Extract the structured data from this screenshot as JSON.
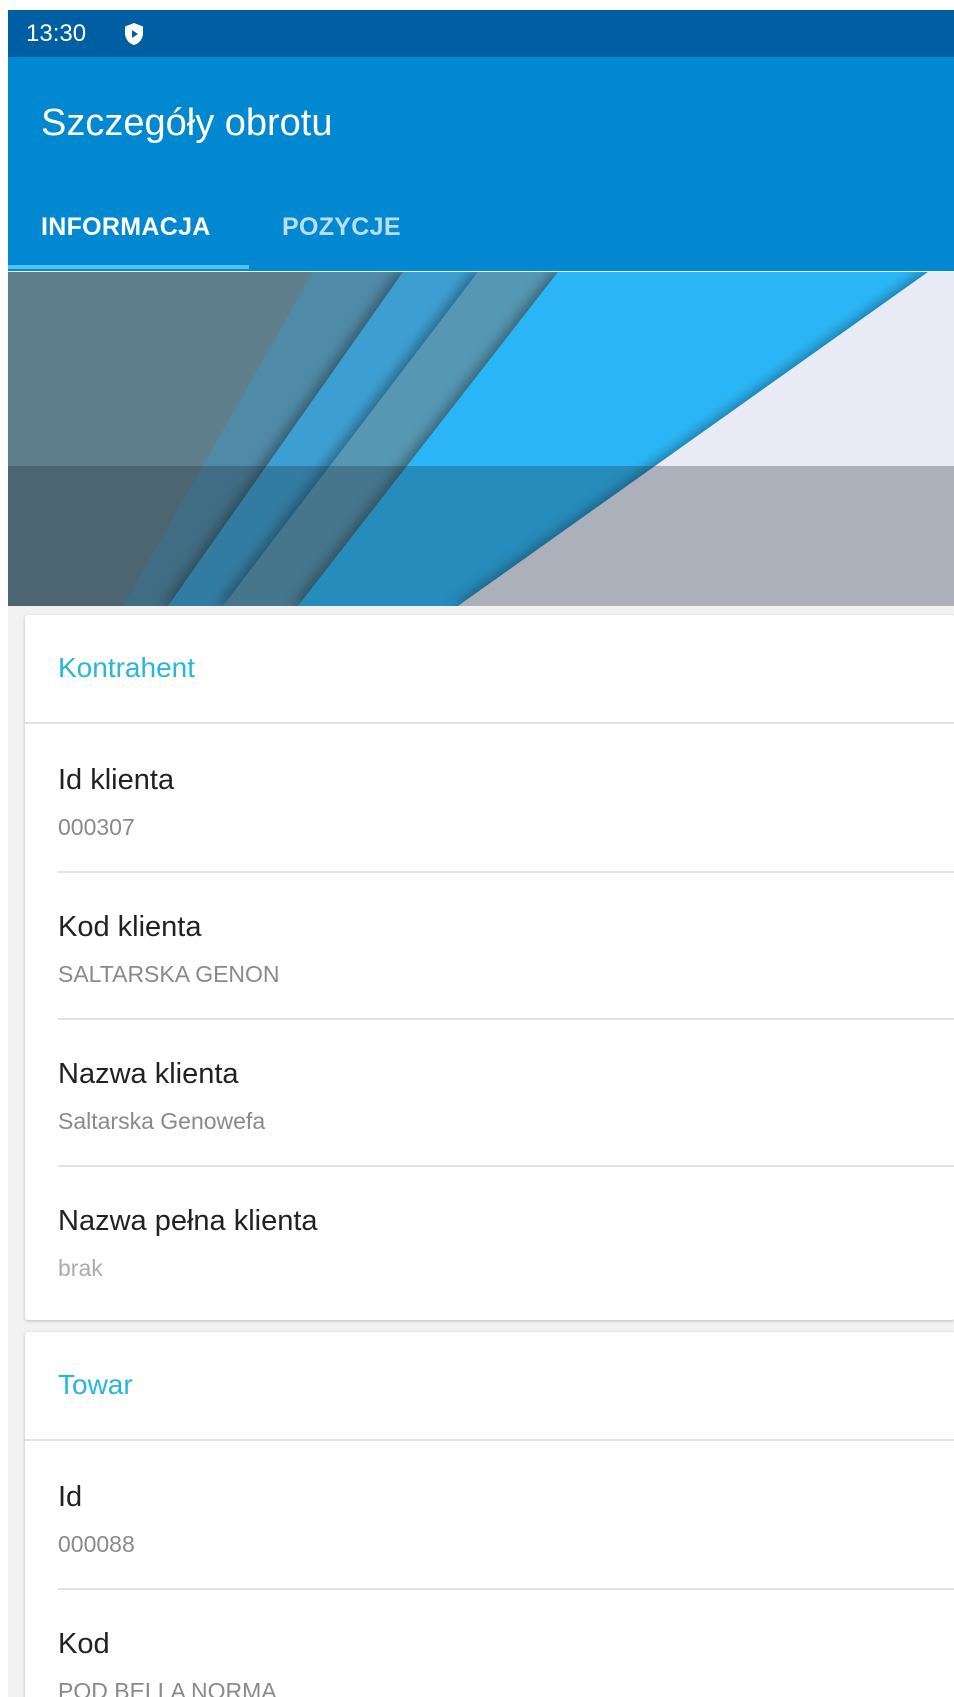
{
  "status_bar": {
    "time": "13:30",
    "icon": "shield-icon"
  },
  "app_bar": {
    "title": "Szczegóły obrotu",
    "tabs": [
      {
        "label": "INFORMACJA",
        "selected": true
      },
      {
        "label": "POZYCJE",
        "selected": false
      }
    ]
  },
  "colors": {
    "status_bar": "#005fa3",
    "app_bar": "#0288d1",
    "tab_indicator": "#4fc3f7",
    "section_title": "#26b8d6"
  },
  "sections": [
    {
      "title": "Kontrahent",
      "fields": [
        {
          "label": "Id klienta",
          "value": "000307"
        },
        {
          "label": "Kod klienta",
          "value": "SALTARSKA GENON"
        },
        {
          "label": "Nazwa klienta",
          "value": "Saltarska Genowefa"
        },
        {
          "label": "Nazwa pełna klienta",
          "value": "brak"
        }
      ]
    },
    {
      "title": "Towar",
      "fields": [
        {
          "label": "Id",
          "value": "000088"
        },
        {
          "label": "Kod",
          "value": "POD BELLA NORMA"
        }
      ]
    }
  ]
}
